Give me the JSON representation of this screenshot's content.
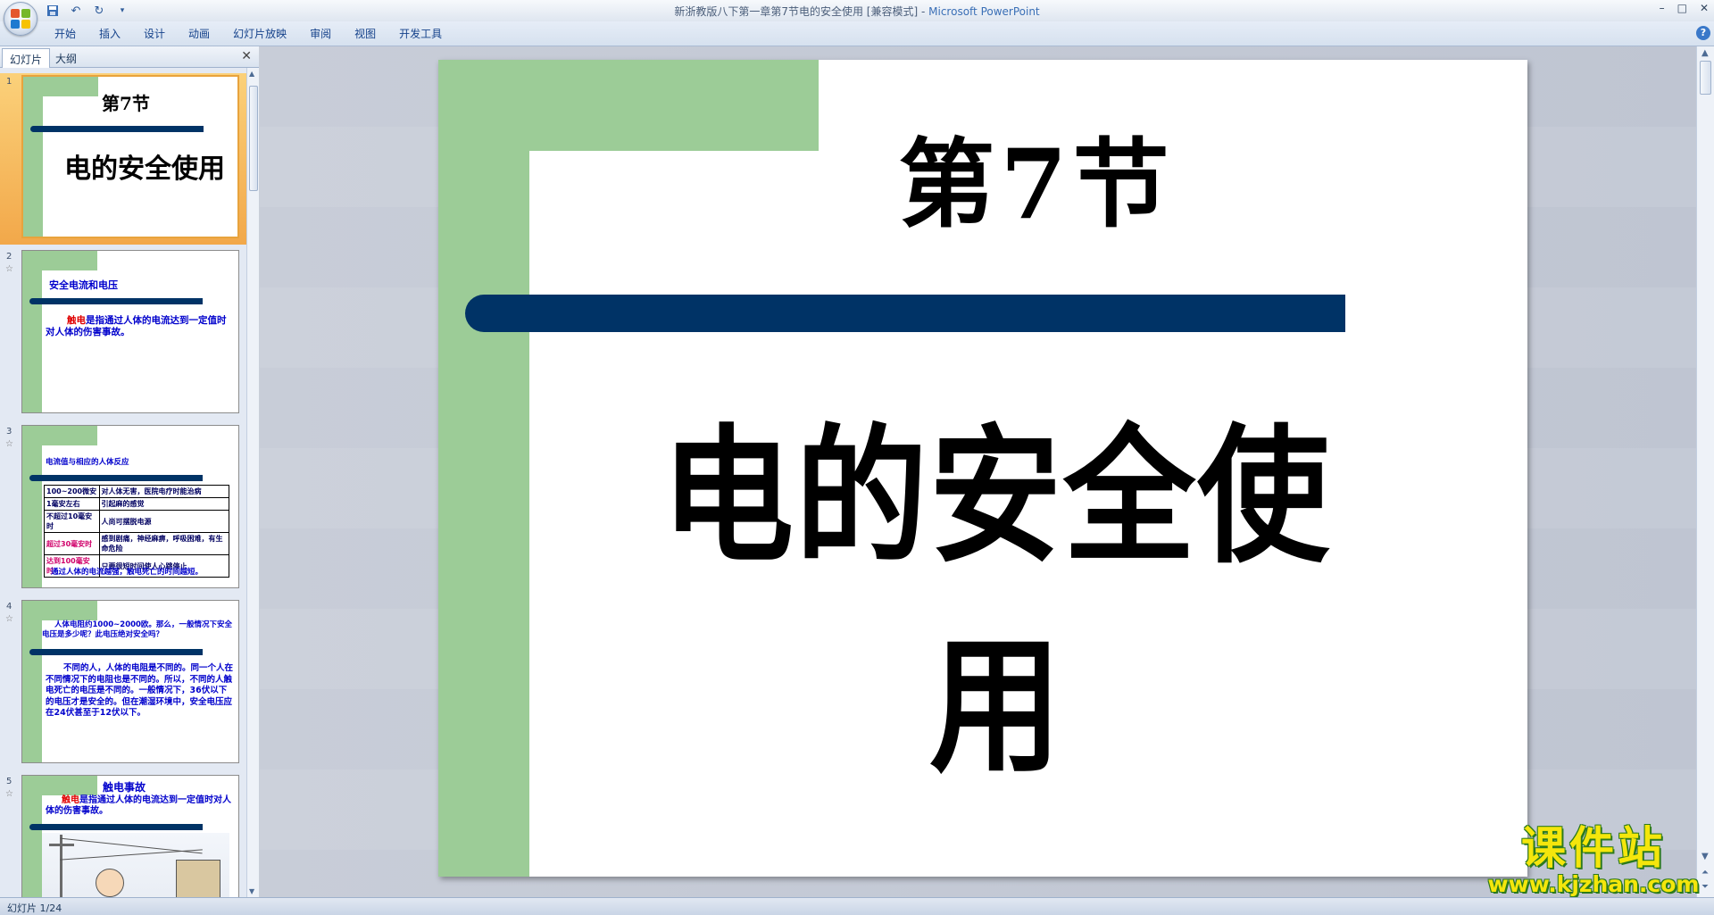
{
  "window": {
    "title": "新浙教版八下第一章第7节电的安全使用 [兼容模式] - ",
    "app_name": "Microsoft PowerPoint",
    "minimize": "–",
    "maximize": "□",
    "close": "✕"
  },
  "quick_access": {
    "save_icon": "save-icon",
    "undo_icon": "undo-icon",
    "redo_icon": "redo-icon",
    "customize": "▾"
  },
  "ribbon": {
    "tabs": [
      "开始",
      "插入",
      "设计",
      "动画",
      "幻灯片放映",
      "审阅",
      "视图",
      "开发工具"
    ],
    "help": "?"
  },
  "left_pane": {
    "tab_slides": "幻灯片",
    "tab_outline": "大纲",
    "close": "✕",
    "thumbnails": [
      {
        "num": "1",
        "title": "第7节",
        "subtitle": "电的安全使用"
      },
      {
        "num": "2",
        "star": "☆",
        "heading": "安全电流和电压",
        "body_highlight": "触电",
        "body": "是指通过人体的电流达到一定值时对人体的伤害事故。"
      },
      {
        "num": "3",
        "star": "☆",
        "heading": "电流值与相应的人体反应",
        "table": [
          [
            "100~200微安",
            "对人体无害，医院电疗时能治病"
          ],
          [
            "1毫安左右",
            "引起麻的感觉"
          ],
          [
            "不超过10毫安时",
            "人尚可摆脱电源"
          ],
          [
            "超过30毫安时",
            "感到剧痛，神经麻痹，呼吸困难，有生命危险"
          ],
          [
            "达到100毫安时",
            "只要很短时间使人心跳停止"
          ]
        ],
        "footer": "通过人体的电流越强，触电死亡的时间越短。"
      },
      {
        "num": "4",
        "star": "☆",
        "question": "人体电阻约1000~2000欧。那么，一般情况下安全电压是多少呢？此电压绝对安全吗？",
        "body": "不同的人，人体的电阻是不同的。同一个人在不同情况下的电阻也是不同的。所以，不同的人触电死亡的电压是不同的。一般情况下，36伏以下的电压才是安全的。但在潮湿环境中，安全电压应在24伏甚至于12伏以下。"
      },
      {
        "num": "5",
        "star": "☆",
        "heading": "触电事故",
        "body_highlight": "触电",
        "body": "是指通过人体的电流达到一定值时对人体的伤害事故。"
      }
    ]
  },
  "slide": {
    "title": "第7节",
    "subtitle": "电的安全使用"
  },
  "watermark": {
    "big": "课件站",
    "url": "www.kjzhan.com"
  },
  "status": {
    "text": "幻灯片 1/24"
  },
  "colors": {
    "accent_green": "#9ccc97",
    "accent_navy": "#003366",
    "ribbon_text": "#15428b"
  }
}
